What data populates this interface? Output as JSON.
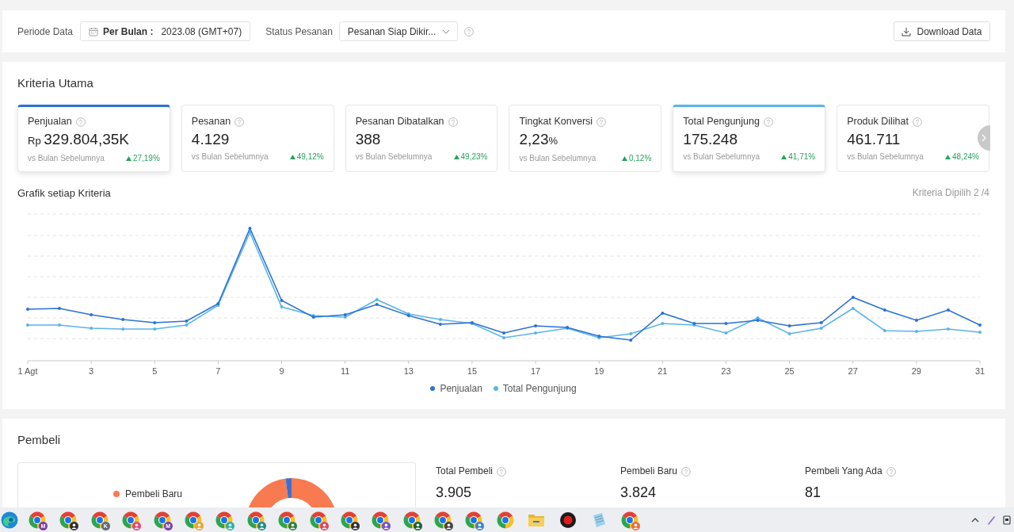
{
  "filter_bar": {
    "period_label": "Periode Data",
    "period_picker": {
      "prefix": "Per Bulan :",
      "value": "2023.08 (GMT+07)"
    },
    "status_label": "Status Pesanan",
    "status_select": {
      "value": "Pesanan Siap Dikir..."
    },
    "download_button": "Download Data"
  },
  "key_metrics": {
    "title": "Kriteria Utama",
    "cards": [
      {
        "label": "Penjualan",
        "prefix": "Rp",
        "value": "329.804,35K",
        "comparison": "vs Bulan Sebelumnya",
        "change": "27,19%",
        "selected": true,
        "color": "#2a72d4"
      },
      {
        "label": "Pesanan",
        "value": "4.129",
        "comparison": "vs Bulan Sebelumnya",
        "change": "49,12%",
        "selected": false
      },
      {
        "label": "Pesanan Dibatalkan",
        "value": "388",
        "comparison": "vs Bulan Sebelumnya",
        "change": "49,23%",
        "selected": false
      },
      {
        "label": "Tingkat Konversi",
        "value": "2,23",
        "suffix": "%",
        "comparison": "vs Bulan Sebelumnya",
        "change": "0,12%",
        "selected": false
      },
      {
        "label": "Total Pengunjung",
        "value": "175.248",
        "comparison": "vs Bulan Sebelumnya",
        "change": "41,71%",
        "selected": true,
        "color": "#5ab4ea"
      },
      {
        "label": "Produk Dilihat",
        "value": "461.711",
        "comparison": "vs Bulan Sebelumnya",
        "change": "48,24%",
        "selected": false
      }
    ]
  },
  "chart": {
    "title": "Grafik setiap Kriteria",
    "selection_info": "Kriteria Dipilih 2 /4",
    "x_labels": [
      "1 Agt",
      "3",
      "5",
      "7",
      "9",
      "11",
      "13",
      "15",
      "17",
      "19",
      "21",
      "23",
      "25",
      "27",
      "29",
      "31"
    ],
    "legend": [
      {
        "label": "Penjualan",
        "color": "#2a72d4"
      },
      {
        "label": "Total Pengunjung",
        "color": "#5ab4ea"
      }
    ]
  },
  "buyers": {
    "title": "Pembeli",
    "legend": [
      {
        "label": "Pembeli Baru",
        "color": "#f87a50"
      }
    ],
    "metrics": [
      {
        "label": "Total Pembeli",
        "value": "3.905"
      },
      {
        "label": "Pembeli Baru",
        "value": "3.824"
      },
      {
        "label": "Pembeli Yang Ada",
        "value": "81"
      }
    ]
  },
  "taskbar": {
    "apps": [
      {
        "kind": "edge"
      },
      {
        "kind": "browser",
        "badge": "M",
        "color": "#7b3fa6"
      },
      {
        "kind": "browser",
        "color": "#2d2d2d"
      },
      {
        "kind": "browser",
        "badge": "K",
        "color": "#5f6b7a"
      },
      {
        "kind": "browser",
        "color": "#e0457b"
      },
      {
        "kind": "browser",
        "badge": "M",
        "color": "#7b3fa6"
      },
      {
        "kind": "browser",
        "color": "#e8a33a"
      },
      {
        "kind": "browser",
        "color": "#2bb3a3"
      },
      {
        "kind": "browser",
        "color": "#1f8a8a"
      },
      {
        "kind": "browser",
        "color": "#2d7d46"
      },
      {
        "kind": "browser",
        "color": "#d9485f"
      },
      {
        "kind": "browser",
        "color": "#333333"
      },
      {
        "kind": "browser",
        "color": "#7b4fc9"
      },
      {
        "kind": "browser",
        "color": "#1d5e3a"
      },
      {
        "kind": "browser",
        "color": "#444444"
      },
      {
        "kind": "browser",
        "color": "#3b82d6"
      },
      {
        "kind": "browser"
      },
      {
        "kind": "folder"
      },
      {
        "kind": "recorder"
      },
      {
        "kind": "notepad"
      },
      {
        "kind": "browser",
        "color": "#e8703a"
      }
    ]
  }
}
